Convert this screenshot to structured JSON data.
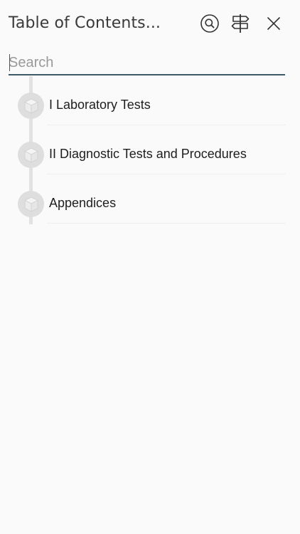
{
  "header": {
    "title": "Table of Contents...",
    "icons": [
      "search-icon",
      "signpost-icon",
      "close-icon"
    ]
  },
  "search": {
    "placeholder": "Search",
    "value": ""
  },
  "toc": {
    "items": [
      {
        "label": "I Laboratory Tests",
        "icon": "cube-icon"
      },
      {
        "label": "II Diagnostic Tests and Procedures",
        "icon": "cube-icon"
      },
      {
        "label": "Appendices",
        "icon": "cube-icon"
      }
    ]
  },
  "colors": {
    "background": "#fafafa",
    "accent_underline": "#3e5a66",
    "rail": "#e2e2e2",
    "node": "#dedede"
  }
}
